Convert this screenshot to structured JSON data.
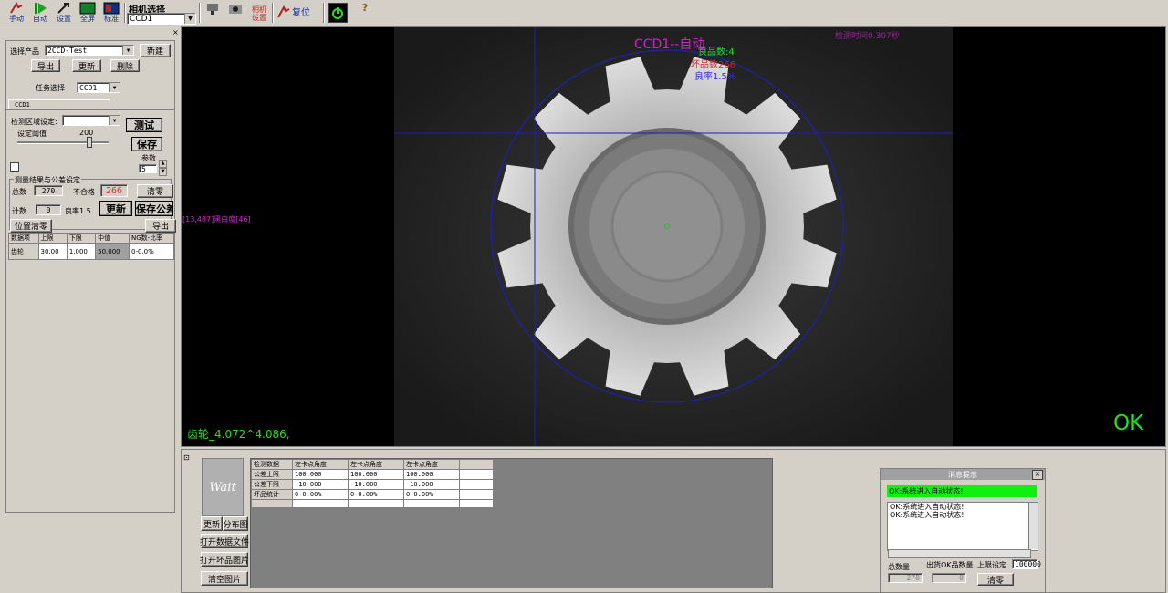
{
  "toolbar": {
    "buttons": [
      {
        "label": "手动",
        "icon": "manual-run-icon"
      },
      {
        "label": "自动",
        "icon": "auto-play-icon"
      },
      {
        "label": "设置",
        "icon": "settings-icon"
      },
      {
        "label": "全屏",
        "icon": "fullscreen-icon"
      },
      {
        "label": "标准",
        "icon": "standard-icon"
      }
    ],
    "camera_select_label": "相机选择",
    "camera_select_value": "CCD1",
    "camera_settings_label": "相机\n设置",
    "reset_label": "复位",
    "power_icon": "power-icon",
    "help_icon": "help-icon"
  },
  "left": {
    "product_label": "选择产品",
    "product_value": "2CCD-Test",
    "new_btn": "新建",
    "export_btn": "导出",
    "update_btn": "更新",
    "delete_btn": "删除",
    "task_label": "任务选择",
    "task_value": "CCD1",
    "tab_label": "CCD1",
    "region_label": "检测区域设定:",
    "region_value": "",
    "test_btn": "测试",
    "threshold_label": "设定阈值",
    "threshold_value": "200",
    "save_btn": "保存",
    "param_label": "参数",
    "param_value": "5",
    "group_title": "测量结果与公差设定",
    "total_label": "总数",
    "total_value": "270",
    "ng_label": "不合格",
    "ng_value": "266",
    "clear_btn": "清零",
    "count_label": "计数",
    "count_value": "0",
    "yield_label": "良率1.5",
    "refresh_btn": "更新",
    "save_tol_btn": "保存公差",
    "pos_clear_btn": "位置清零",
    "export2_btn": "导出",
    "table_headers": [
      "数据项",
      "上限",
      "下限",
      "中值",
      "NG数-比率"
    ],
    "table_rows": [
      [
        "齿轮",
        "30.00",
        "1.000",
        "50.000",
        "0-0.0%"
      ]
    ]
  },
  "viewport": {
    "overlay_title": "CCD1--自动",
    "good_count": "良品数:4",
    "bad_count": "坏品数266",
    "yield": "良率1.5%",
    "detect_time": "检测时间0.307秒",
    "pixel_info": "[13,487]黑白度[46]",
    "measure_text": "齿轮_4.072^4.086,",
    "result": "OK",
    "color_title": "#d020d0",
    "color_ok": "#20e020"
  },
  "bottom": {
    "wait_text": "Wait",
    "update_btn": "更新",
    "distribution_btn": "分布图",
    "open_data_btn": "打开数据文件",
    "open_ng_btn": "打开坏品图片",
    "clear_img_btn": "清空图片",
    "grid_headers": [
      "检测数据",
      "左卡点角度",
      "左卡点角度",
      "左卡点角度",
      ""
    ],
    "grid_rows": [
      [
        "公差上限",
        "100.000",
        "100.000",
        "100.000",
        ""
      ],
      [
        "公差下限",
        "-10.000",
        "-10.000",
        "-10.000",
        ""
      ],
      [
        "坏品统计",
        "0-0.00%",
        "0-0.00%",
        "0-0.00%",
        ""
      ],
      [
        "",
        "",
        "",
        "",
        ""
      ]
    ]
  },
  "messages": {
    "title": "消息提示",
    "banner": "OK:系统进入自动状态!",
    "log": [
      "OK:系统进入自动状态!",
      "OK:系统进入自动状态!"
    ],
    "total_label": "总数量",
    "total_value": "270",
    "ok_out_label": "出货OK品数量",
    "ok_out_value": "0",
    "limit_label": "上限设定",
    "limit_value": "100000",
    "clear_btn": "清零"
  }
}
